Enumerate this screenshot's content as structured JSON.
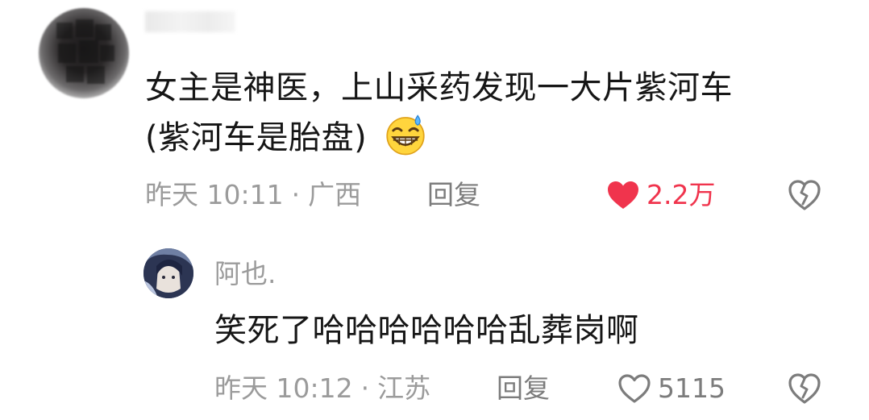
{
  "comment": {
    "text_line1": "女主是神医，上山采药发现一大片紫河车",
    "text_line2": "(紫河车是胎盘)",
    "emoji": "grinning-sweat-face",
    "time": "昨天 10:11",
    "location": "广西",
    "dot": "·",
    "reply_label": "回复",
    "likes": "2.2万",
    "liked": true,
    "like_color": "#f0344d"
  },
  "reply": {
    "username": "阿也.",
    "text": "笑死了哈哈哈哈哈哈乱葬岗啊",
    "time": "昨天 10:12",
    "location": "江苏",
    "dot": "·",
    "reply_label": "回复",
    "likes": "5115",
    "liked": false
  },
  "colors": {
    "text_primary": "#161616",
    "text_secondary": "#9b9b9b",
    "icon_gray": "#7c7c7c"
  }
}
